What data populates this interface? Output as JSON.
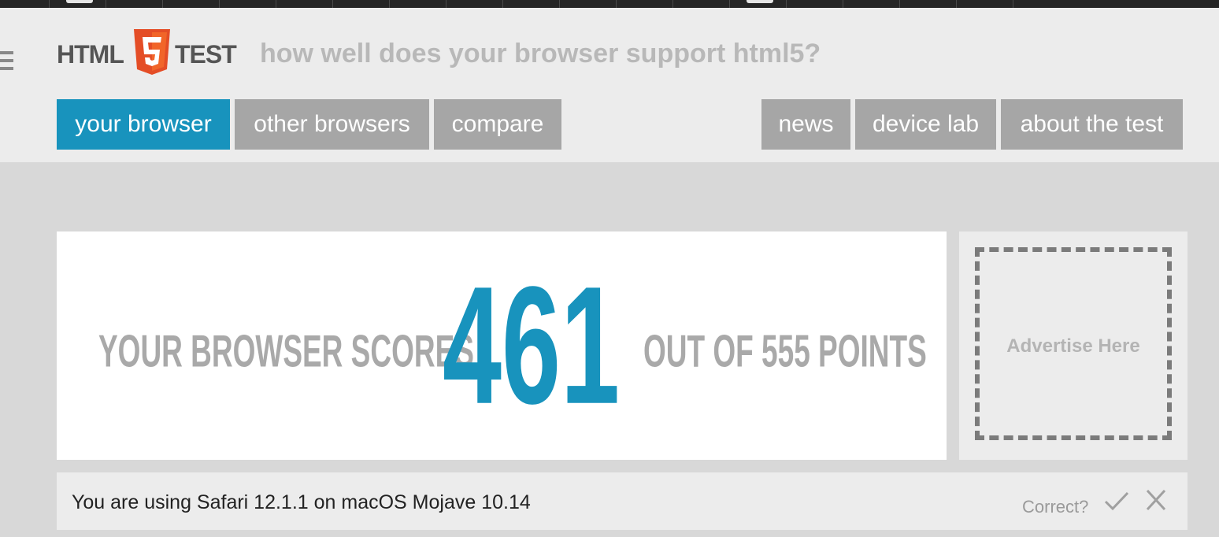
{
  "logo": {
    "part1": "HTML",
    "badge": "5",
    "part2": "TEST",
    "badge_color": "#e44d26"
  },
  "tagline": "how well does your browser support html5?",
  "nav": {
    "left": [
      {
        "label": "your browser",
        "active": true
      },
      {
        "label": "other browsers",
        "active": false
      },
      {
        "label": "compare",
        "active": false
      }
    ],
    "right": [
      {
        "label": "news"
      },
      {
        "label": "device lab"
      },
      {
        "label": "about the test"
      }
    ]
  },
  "score": {
    "prefix": "YOUR BROWSER SCORES",
    "value": "461",
    "suffix": "OUT OF 555 POINTS"
  },
  "ad": {
    "label": "Advertise Here"
  },
  "browser_info": {
    "text": "You are using Safari 12.1.1 on macOS Mojave 10.14",
    "correct_label": "Correct?"
  },
  "icons": {
    "menu": "hamburger-menu-icon",
    "confirm": "checkmark-icon",
    "reject": "close-icon"
  },
  "colors": {
    "accent": "#1893bd",
    "nav_inactive": "#a6a6a6",
    "header_bg": "#ececec",
    "page_bg": "#d8d8d8"
  }
}
